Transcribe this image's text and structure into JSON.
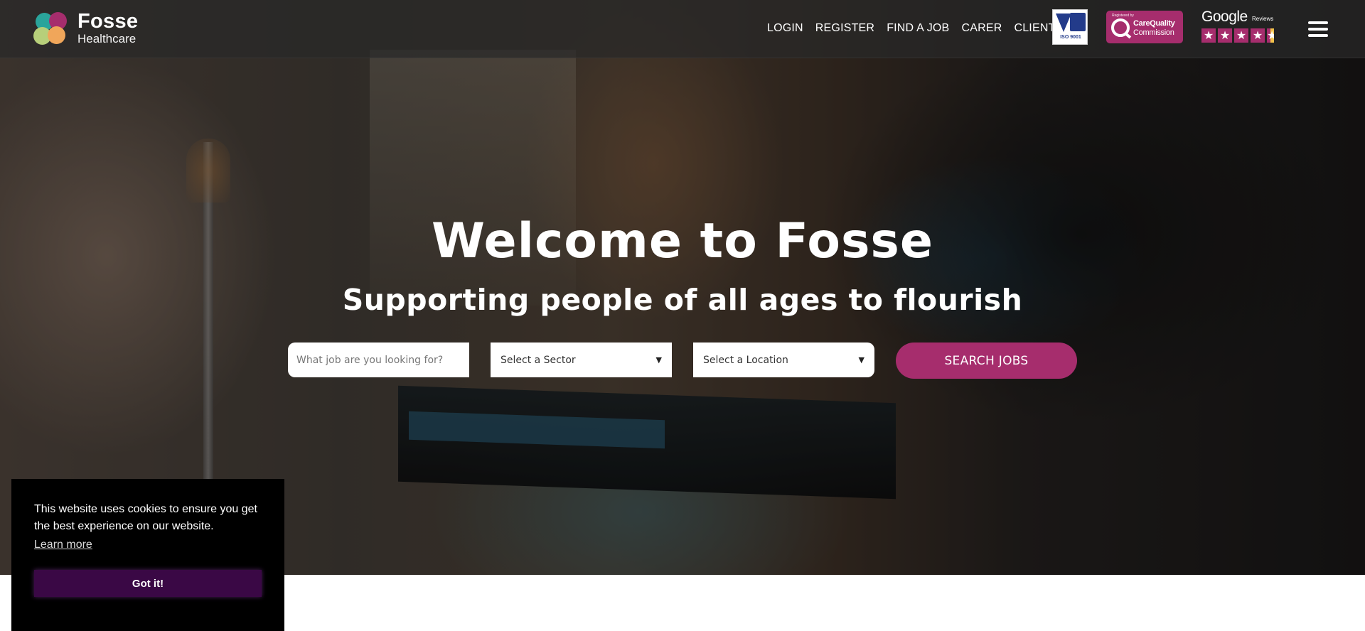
{
  "header": {
    "brand": "Fosse",
    "brand_sub": "Healthcare",
    "nav": [
      "LOGIN",
      "REGISTER",
      "FIND A JOB",
      "CARER",
      "CLIENT"
    ],
    "badges": {
      "iso_text": "ISO 9001",
      "cqc_registered": "Registered by",
      "cqc_line1": "CareQuality",
      "cqc_line2": "Commission",
      "google_word": "Google",
      "google_reviews": "Reviews",
      "rating_stars": 4.5
    },
    "menu_icon": "hamburger-menu-icon"
  },
  "hero": {
    "title": "Welcome to Fosse",
    "subtitle": "Supporting people of all ages to flourish"
  },
  "search": {
    "job_placeholder": "What job are you looking for?",
    "sector_selected": "Select a Sector",
    "location_selected": "Select a Location",
    "button": "SEARCH JOBS"
  },
  "cookie": {
    "message": "This website uses cookies to ensure you get the best experience on our website.",
    "learn_more": "Learn more",
    "accept": "Got it!"
  },
  "colors": {
    "brand_magenta": "#a62d6d",
    "header_bg": "#282828",
    "cookie_bg": "#000000",
    "cookie_button": "#3a0845"
  }
}
